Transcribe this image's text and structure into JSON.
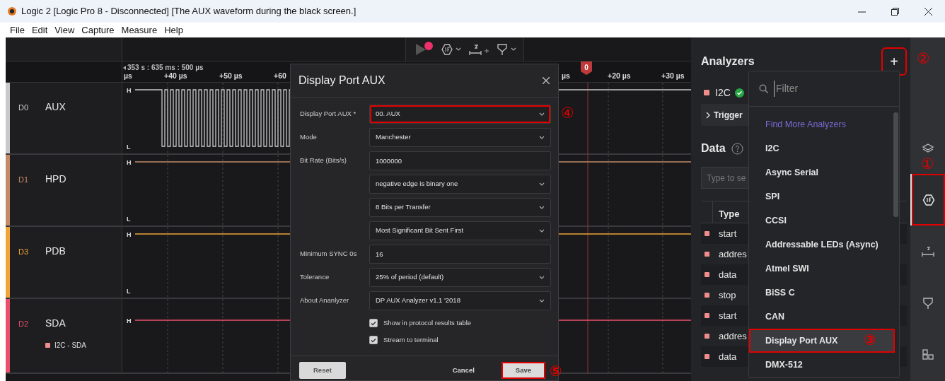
{
  "window": {
    "title": "Logic 2 [Logic Pro 8 - Disconnected] [The AUX waveform during the black screen.]"
  },
  "menu": [
    "File",
    "Edit",
    "View",
    "Capture",
    "Measure",
    "Help"
  ],
  "ruler": {
    "timestamp": "353 s : 635 ms : 500 µs",
    "ticks": [
      "µs",
      "+40 µs",
      "+50 µs",
      "+60",
      "µs",
      "+20 µs",
      "+30 µs"
    ],
    "marker": "0"
  },
  "channels": [
    {
      "id": "D0",
      "name": "AUX",
      "color": "#c8c8c8",
      "kind": "clock",
      "levels": [
        "H",
        "L"
      ]
    },
    {
      "id": "D1",
      "name": "HPD",
      "color": "#c28a6a",
      "kind": "steady",
      "levels": [
        "H",
        "L"
      ]
    },
    {
      "id": "D3",
      "name": "PDB",
      "color": "#f0a43a",
      "kind": "steady",
      "levels": [
        "H",
        "L"
      ]
    },
    {
      "id": "D2",
      "name": "SDA",
      "color": "#e8506e",
      "kind": "steady",
      "levels": [
        "H"
      ],
      "analyzer": {
        "label": "I2C - SDA",
        "color": "#f08c8c"
      }
    }
  ],
  "dialog": {
    "title": "Display Port AUX",
    "fields": [
      {
        "label": "Display Port AUX *",
        "kind": "select",
        "value": "00.  AUX",
        "annotation": "④"
      },
      {
        "label": "Mode",
        "kind": "select",
        "value": "Manchester"
      },
      {
        "label": "Bit Rate (Bits/s)",
        "kind": "input",
        "value": "1000000"
      },
      {
        "kind": "select",
        "value": "negative edge is binary one"
      },
      {
        "kind": "select",
        "value": "8 Bits per Transfer"
      },
      {
        "kind": "select",
        "value": "Most Significant Bit Sent First"
      },
      {
        "label": "Minimum SYNC 0s",
        "kind": "input",
        "value": "16"
      },
      {
        "label": "Tolerance",
        "kind": "select",
        "value": "25% of period (default)"
      },
      {
        "label": "About Ananlyzer",
        "kind": "select",
        "value": "DP AUX Analyzer v1.1 '2018"
      }
    ],
    "checkboxes": [
      {
        "label": "Show in protocol results table",
        "checked": true
      },
      {
        "label": "Stream to terminal",
        "checked": true
      }
    ],
    "buttons": [
      {
        "label": "Reset",
        "kind": "secondary"
      },
      {
        "label": "Cancel",
        "kind": "text"
      },
      {
        "label": "Save",
        "kind": "primary",
        "annotation": "⑤"
      }
    ]
  },
  "analyzers_panel": {
    "title": "Analyzers",
    "add_button": {
      "label": "+",
      "annotation": "②"
    },
    "analyzers": [
      {
        "name": "I2C",
        "color": "#f08c8c",
        "ok": true
      }
    ],
    "trigger_label": "Trigger",
    "data_title": "Data",
    "search_placeholder": "Type to se",
    "table": {
      "columns": [
        "Type"
      ],
      "rows": [
        {
          "type": "start",
          "color": "#f08c8c"
        },
        {
          "type": "addres",
          "color": "#f08c8c"
        },
        {
          "type": "data",
          "color": "#f08c8c"
        },
        {
          "type": "stop",
          "color": "#f08c8c"
        },
        {
          "type": "start",
          "color": "#f08c8c"
        },
        {
          "type": "addres",
          "color": "#f08c8c"
        },
        {
          "type": "data",
          "color": "#f08c8c"
        }
      ]
    }
  },
  "analyzer_menu": {
    "placeholder": "Filter",
    "items": [
      {
        "label": "Find More Analyzers",
        "kind": "link",
        "selected": false
      },
      {
        "label": "I2C",
        "kind": "item",
        "selected": false
      },
      {
        "label": "Async Serial",
        "kind": "item",
        "selected": false
      },
      {
        "label": "SPI",
        "kind": "item",
        "selected": false
      },
      {
        "label": "CCSI",
        "kind": "item",
        "selected": false
      },
      {
        "label": "Addressable LEDs (Async)",
        "kind": "item",
        "selected": false
      },
      {
        "label": "Atmel SWI",
        "kind": "item",
        "selected": false
      },
      {
        "label": "BiSS C",
        "kind": "item",
        "selected": false
      },
      {
        "label": "CAN",
        "kind": "item",
        "selected": false
      },
      {
        "label": "Display Port AUX",
        "kind": "item",
        "selected": true,
        "annotation": "③"
      },
      {
        "label": "DMX-512",
        "kind": "item",
        "selected": false
      }
    ]
  },
  "sidebar": [
    {
      "kind": "layers",
      "selected": false
    },
    {
      "kind": "analyzer",
      "selected": true,
      "annotation": "①"
    },
    {
      "kind": "measure",
      "selected": false
    },
    {
      "kind": "trigger",
      "selected": false
    },
    {
      "kind": "layout",
      "selected": false
    }
  ]
}
